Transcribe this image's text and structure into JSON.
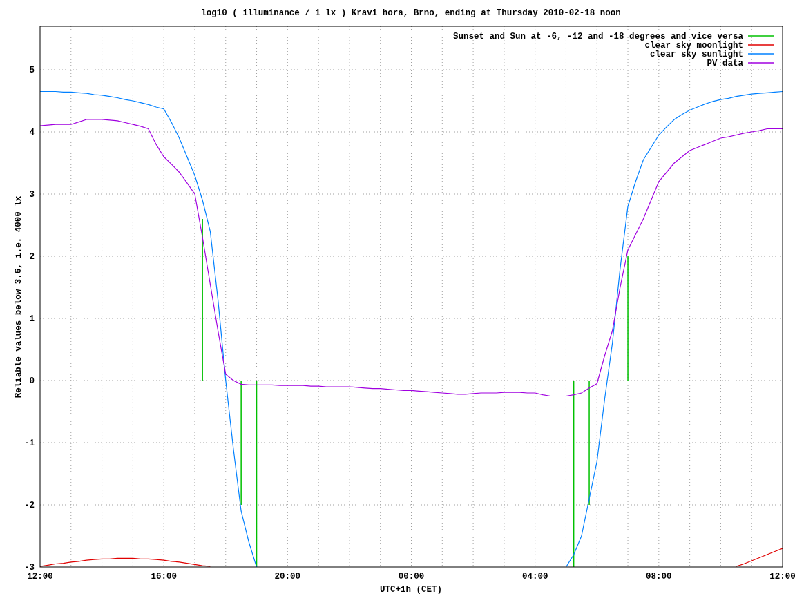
{
  "chart_data": {
    "type": "line",
    "title": "log10 ( illuminance / 1 lx ) Kravi hora, Brno, ending at Thursday 2010-02-18 noon",
    "xlabel": "UTC+1h (CET)",
    "ylabel": "Reliable values below 3.6, i.e. 4000 lx",
    "categories": [
      "12:00",
      null,
      null,
      null,
      null,
      null,
      null,
      null,
      null,
      null,
      null,
      null,
      null,
      null,
      null,
      null,
      "16:00",
      null,
      null,
      null,
      null,
      null,
      null,
      null,
      null,
      null,
      null,
      null,
      null,
      null,
      null,
      null,
      "20:00",
      null,
      null,
      null,
      null,
      null,
      null,
      null,
      null,
      null,
      null,
      null,
      null,
      null,
      null,
      null,
      "00:00",
      null,
      null,
      null,
      null,
      null,
      null,
      null,
      null,
      null,
      null,
      null,
      null,
      null,
      null,
      null,
      "04:00",
      null,
      null,
      null,
      null,
      null,
      null,
      null,
      null,
      null,
      null,
      null,
      null,
      null,
      null,
      null,
      "08:00",
      null,
      null,
      null,
      null,
      null,
      null,
      null,
      null,
      null,
      null,
      null,
      null,
      null,
      null,
      null,
      "12:00"
    ],
    "series": [
      {
        "name": "Sunset and Sun at -6, -12 and -18 degrees and vice versa",
        "color": "#00c000",
        "type": "bar",
        "values": [
          null,
          null,
          null,
          null,
          null,
          null,
          null,
          null,
          null,
          null,
          null,
          null,
          null,
          null,
          null,
          null,
          null,
          null,
          null,
          null,
          null,
          2.6,
          null,
          null,
          null,
          null,
          -2,
          null,
          -3,
          null,
          null,
          null,
          null,
          null,
          null,
          null,
          null,
          null,
          null,
          null,
          null,
          null,
          null,
          null,
          null,
          null,
          null,
          null,
          null,
          null,
          null,
          null,
          null,
          null,
          null,
          null,
          null,
          null,
          null,
          null,
          null,
          null,
          null,
          null,
          null,
          null,
          null,
          null,
          null,
          -3,
          null,
          -2,
          null,
          null,
          null,
          null,
          2,
          null,
          null,
          null,
          null,
          null,
          null,
          null,
          null,
          null,
          null,
          null,
          null,
          null,
          null,
          null,
          null,
          null,
          null,
          null,
          null
        ]
      },
      {
        "name": "clear sky moonlight",
        "color": "#e00000",
        "values": [
          -2.99,
          -2.97,
          -2.95,
          -2.94,
          -2.92,
          -2.91,
          -2.89,
          -2.88,
          -2.87,
          -2.87,
          -2.86,
          -2.86,
          -2.86,
          -2.87,
          -2.87,
          -2.88,
          -2.89,
          -2.91,
          -2.92,
          -2.94,
          -2.96,
          -2.98,
          -2.99,
          null,
          null,
          null,
          null,
          null,
          null,
          null,
          null,
          null,
          null,
          null,
          null,
          null,
          null,
          null,
          null,
          null,
          null,
          null,
          null,
          null,
          null,
          null,
          null,
          null,
          null,
          null,
          null,
          null,
          null,
          null,
          null,
          null,
          null,
          null,
          null,
          null,
          null,
          null,
          null,
          null,
          null,
          null,
          null,
          null,
          null,
          null,
          null,
          null,
          null,
          null,
          null,
          null,
          null,
          null,
          null,
          null,
          null,
          null,
          null,
          null,
          null,
          null,
          null,
          null,
          null,
          null,
          -2.99,
          -2.95,
          -2.9,
          -2.85,
          -2.8,
          -2.75,
          -2.7
        ]
      },
      {
        "name": "clear sky sunlight",
        "color": "#0080ff",
        "values": [
          4.65,
          4.65,
          4.65,
          4.64,
          4.64,
          4.63,
          4.62,
          4.6,
          4.59,
          4.57,
          4.55,
          4.52,
          4.5,
          4.47,
          4.44,
          4.4,
          4.37,
          4.15,
          3.9,
          3.6,
          3.3,
          2.9,
          2.4,
          1.3,
          0.0,
          -1.1,
          -2.1,
          -2.6,
          -3,
          null,
          null,
          null,
          null,
          null,
          null,
          null,
          null,
          null,
          null,
          null,
          null,
          null,
          null,
          null,
          null,
          null,
          null,
          null,
          null,
          null,
          null,
          null,
          null,
          null,
          null,
          null,
          null,
          null,
          null,
          null,
          null,
          null,
          null,
          null,
          null,
          null,
          null,
          null,
          -3,
          -2.8,
          -2.5,
          -1.9,
          -1.3,
          -0.3,
          0.6,
          1.8,
          2.8,
          3.2,
          3.55,
          3.75,
          3.95,
          4.08,
          4.2,
          4.28,
          4.35,
          4.4,
          4.45,
          4.49,
          4.52,
          4.54,
          4.57,
          4.59,
          4.61,
          4.62,
          4.63,
          4.64,
          4.65
        ]
      },
      {
        "name": "PV data",
        "color": "#a000e0",
        "values": [
          4.1,
          4.11,
          4.12,
          4.12,
          4.12,
          4.16,
          4.2,
          4.2,
          4.2,
          4.19,
          4.18,
          4.15,
          4.12,
          4.09,
          4.05,
          3.8,
          3.6,
          3.48,
          3.35,
          3.18,
          3.0,
          2.3,
          1.55,
          0.8,
          0.1,
          0.0,
          -0.06,
          -0.07,
          -0.07,
          -0.07,
          -0.07,
          -0.08,
          -0.08,
          -0.08,
          -0.08,
          -0.09,
          -0.09,
          -0.1,
          -0.1,
          -0.1,
          -0.1,
          -0.11,
          -0.12,
          -0.13,
          -0.13,
          -0.14,
          -0.15,
          -0.16,
          -0.16,
          -0.17,
          -0.18,
          -0.19,
          -0.2,
          -0.21,
          -0.22,
          -0.22,
          -0.21,
          -0.2,
          -0.2,
          -0.2,
          -0.19,
          -0.19,
          -0.19,
          -0.2,
          -0.2,
          -0.23,
          -0.25,
          -0.25,
          -0.25,
          -0.23,
          -0.2,
          -0.12,
          -0.05,
          0.4,
          0.8,
          1.5,
          2.1,
          2.35,
          2.6,
          2.9,
          3.2,
          3.35,
          3.5,
          3.6,
          3.7,
          3.75,
          3.8,
          3.85,
          3.9,
          3.92,
          3.95,
          3.98,
          4.0,
          4.02,
          4.05,
          4.05,
          4.05
        ]
      }
    ],
    "ylim": [
      -3,
      5.7
    ],
    "yticks": [
      -3,
      -2,
      -1,
      0,
      1,
      2,
      3,
      4,
      5
    ],
    "grid": true,
    "legend": true
  }
}
